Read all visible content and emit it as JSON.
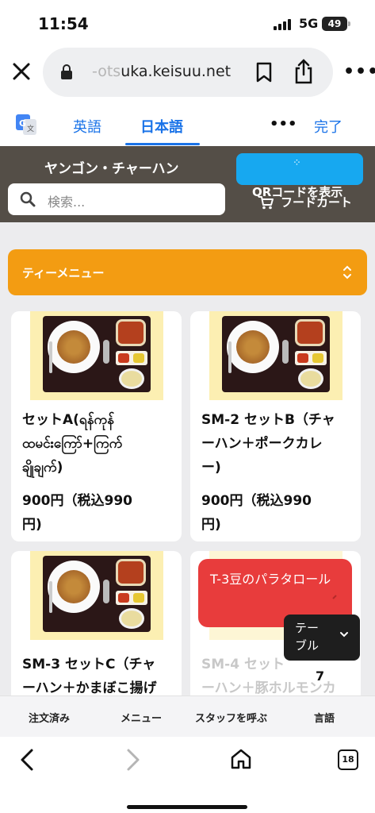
{
  "status_bar": {
    "time": "11:54",
    "network": "5G",
    "battery": "49"
  },
  "browser": {
    "url_faded": "-ots",
    "url_main": "uka.keisuu.net",
    "tab_count": "18"
  },
  "translate_bar": {
    "lang_en": "英語",
    "lang_ja": "日本語",
    "more": "•••",
    "done": "完了"
  },
  "header": {
    "shop_name": "ヤンゴン・チャーハン",
    "search_placeholder": "検索...",
    "qr_label": "QRコードを表示",
    "cart_label": "フードカート"
  },
  "category": {
    "selected": "ティーメニュー"
  },
  "items": [
    {
      "name_l1": "セットA(ရန်ကုန်",
      "name_l2": "ထမင်းကြော်+ကြက်",
      "name_l3": "ချိုချက်)",
      "price_l1": "900円（税込990",
      "price_l2": "円)"
    },
    {
      "name_l1": "SM-2 セットB（チャ",
      "name_l2": "ーハン＋ポークカレ",
      "name_l3": "ー)",
      "price_l1": "900円（税込990",
      "price_l2": "円)"
    },
    {
      "name_l1": "SM-3 セットC（チャ",
      "name_l2": "ーハン＋かまぼこ揚げ"
    },
    {
      "name_l1": "SM-4 セット",
      "name_l2": "ーハン＋豚ホルモンカ"
    }
  ],
  "promo": {
    "text": "T-3豆のパラタロール"
  },
  "table_popup": {
    "label": "テーブル",
    "number": "7"
  },
  "app_nav": {
    "ordered": "注文済み",
    "menu": "メニュー",
    "call_staff": "スタッフを呼ぶ",
    "language": "言語"
  },
  "colors": {
    "header_bg": "#544e47",
    "accent_orange": "#f39c12",
    "qr_blue": "#17a8f0",
    "promo_red": "#e83c3c",
    "link_blue": "#1a73e8"
  }
}
